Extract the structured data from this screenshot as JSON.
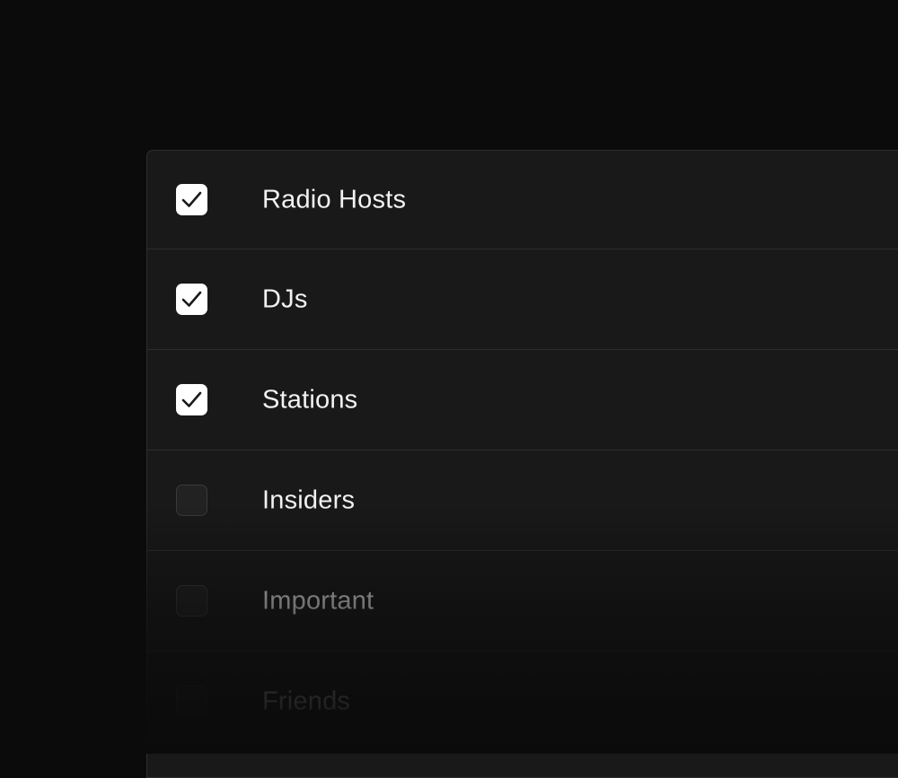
{
  "list": {
    "items": [
      {
        "label": "Radio Hosts",
        "checked": true
      },
      {
        "label": "DJs",
        "checked": true
      },
      {
        "label": "Stations",
        "checked": true
      },
      {
        "label": "Insiders",
        "checked": false
      },
      {
        "label": "Important",
        "checked": false
      },
      {
        "label": "Friends",
        "checked": false
      }
    ]
  },
  "colors": {
    "background": "#0b0b0b",
    "panel": "#191919",
    "divider": "#2d2d2d",
    "checkbox_checked": "#ffffff",
    "checkmark": "#1a1a1a",
    "text": "#f2f2f2"
  }
}
